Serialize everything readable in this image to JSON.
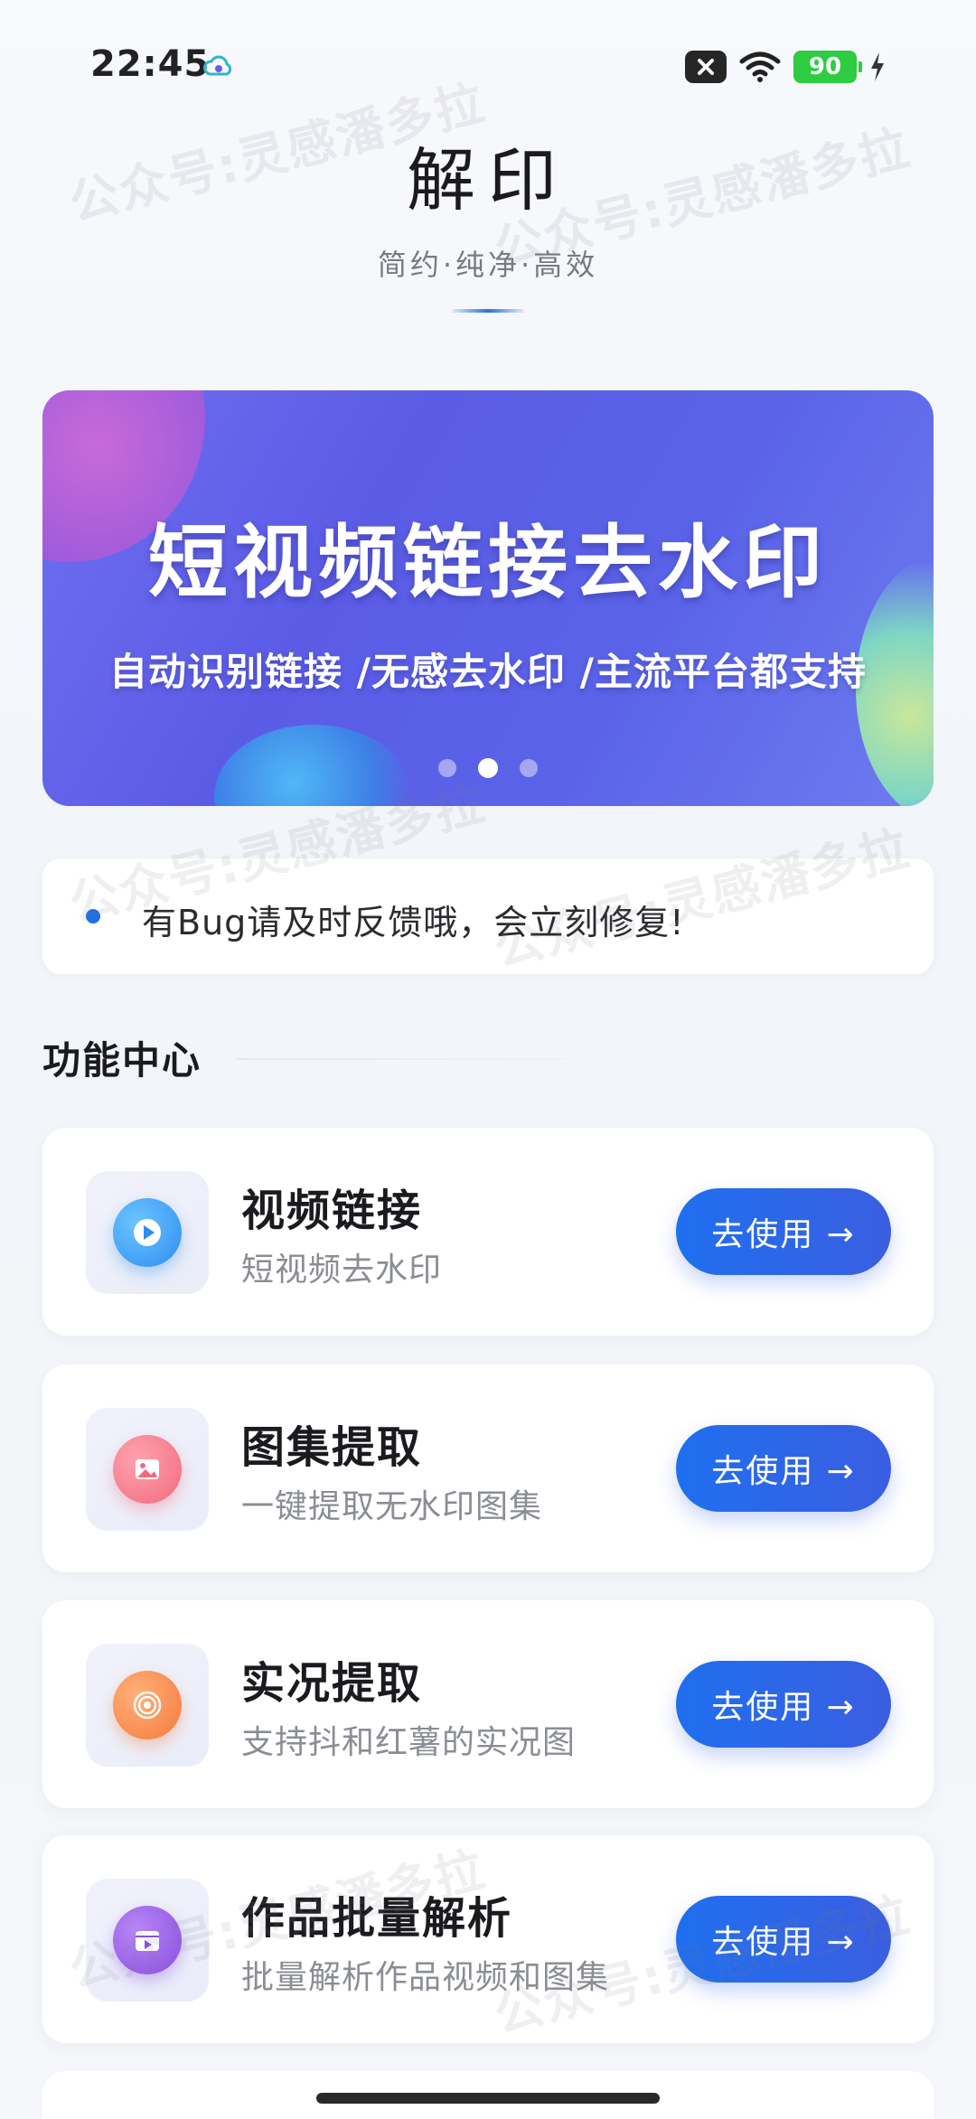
{
  "status_bar": {
    "time": "22:45",
    "battery": "90",
    "icons": [
      "cloud-sync-icon",
      "close-box-icon",
      "wifi-icon",
      "battery-icon",
      "charging-bolt-icon"
    ]
  },
  "header": {
    "title": "解印",
    "subtitle": "简约·纯净·高效"
  },
  "banner": {
    "heading": "短视频链接去水印",
    "subheading": "自动识别链接 /无感去水印 /主流平台都支持",
    "active_slide": 2,
    "slide_count": 3
  },
  "notice": {
    "text": "有Bug请及时反馈哦，会立刻修复!"
  },
  "section": {
    "title": "功能中心"
  },
  "features": [
    {
      "title": "视频链接",
      "description": "短视频去水印",
      "button": "去使用 →",
      "icon": "video-play-icon",
      "color": "#2f8df0"
    },
    {
      "title": "图集提取",
      "description": "一键提取无水印图集",
      "button": "去使用 →",
      "icon": "image-icon",
      "color": "#f06a7e"
    },
    {
      "title": "实况提取",
      "description": "支持抖和红薯的实况图",
      "button": "去使用 →",
      "icon": "live-photo-icon",
      "color": "#f57a3b"
    },
    {
      "title": "作品批量解析",
      "description": "批量解析作品视频和图集",
      "button": "去使用 →",
      "icon": "batch-video-icon",
      "color": "#8a4ee0"
    }
  ],
  "watermark": "公众号:灵感潘多拉",
  "colors": {
    "accent": "#1f6ff0",
    "banner": "#5b5ce6",
    "battery": "#2ecc40"
  }
}
